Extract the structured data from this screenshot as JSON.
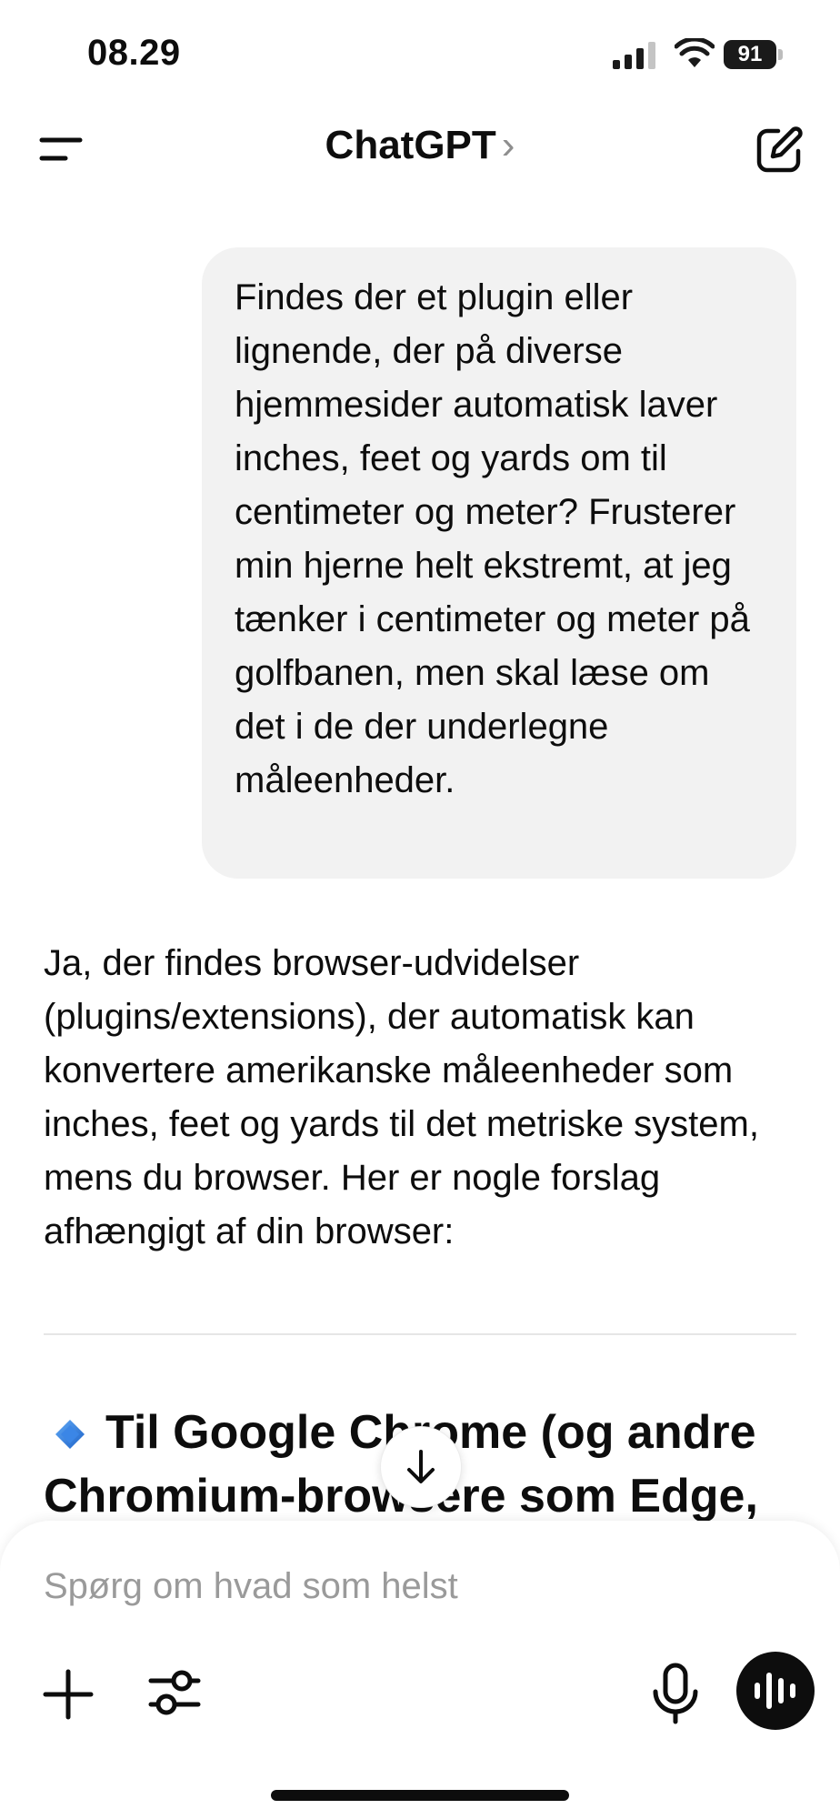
{
  "status_bar": {
    "time": "08.29",
    "battery": "91"
  },
  "nav": {
    "title": "ChatGPT",
    "chevron": "›"
  },
  "messages": {
    "user": "Findes der et plugin eller lignende, der på diverse hjemmesider automatisk laver inches, feet og yards om til centimeter og meter? Frusterer min hjerne helt ekstremt, at jeg tænker i centimeter og meter på golfbanen, men skal læse om det i de der underlegne måleenheder.",
    "assistant": "Ja, der findes browser-udvidelser (plugins/extensions), der automatisk kan konvertere amerikanske måleenheder som inches, feet og yards til det metriske system, mens du browser. Her er nogle forslag afhængigt af din browser:",
    "heading": "Til Google Chrome (og andre Chromium-browsere som Edge,"
  },
  "composer": {
    "placeholder": "Spørg om hvad som helst"
  },
  "icons": {
    "menu": "menu-icon",
    "edit": "new-chat-icon",
    "diamond": "blue-diamond-icon",
    "scroll": "arrow-down-icon",
    "plus": "plus-icon",
    "tools": "sliders-icon",
    "mic": "microphone-icon",
    "voice": "voice-waveform-icon"
  },
  "colors": {
    "bubble": "#f2f2f2",
    "diamond": "#2f7de1",
    "voice_button": "#0d0d0d",
    "placeholder": "#9a9a9a"
  }
}
